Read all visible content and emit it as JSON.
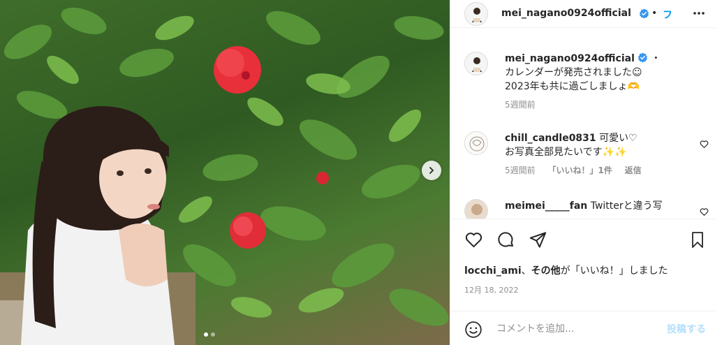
{
  "post": {
    "author": "mei_nagano0924official",
    "follow_label": "フ",
    "more_icon": "more-horizontal-icon",
    "photo_alt": "Woman posing in front of hibiscus bush",
    "carousel": {
      "total": 2,
      "current": 1
    }
  },
  "caption": {
    "author": "mei_nagano0924official",
    "dot": "・",
    "line1": "カレンダーが発売されました☺",
    "line2": "2023年も共に過ごしましょ🫶",
    "age": "5週間前"
  },
  "comments": [
    {
      "username": "chill_candle0831",
      "line1": "可愛い♡",
      "line2": "お写真全部見たいです✨✨",
      "age": "5週間前",
      "likes": "「いいね！」1件",
      "reply": "返信"
    },
    {
      "username": "meimei_____fan",
      "line1": "Twitterと違う写",
      "line2": ""
    }
  ],
  "likes": {
    "users": "locchi_ami",
    "sep": "、",
    "others": "その他",
    "suffix": "が「いいね！」しました"
  },
  "date": "12月 18, 2022",
  "add_comment": {
    "placeholder": "コメントを追加...",
    "post_label": "投稿する"
  },
  "colors": {
    "accent": "#0095f6",
    "verified": "#3897f0",
    "muted": "#8e8e8e",
    "post_disabled": "#b2dffc"
  }
}
